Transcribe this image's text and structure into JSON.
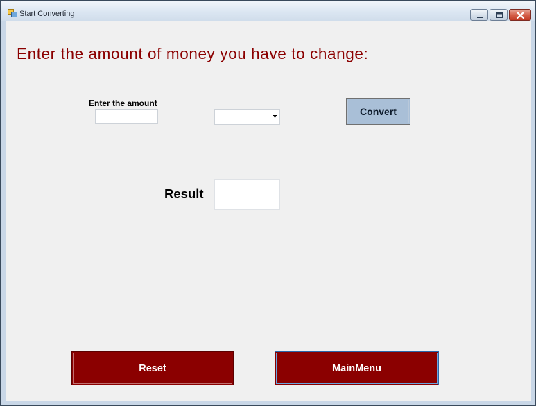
{
  "window": {
    "title": "Start Converting",
    "controls": [
      "minimize",
      "maximize",
      "close"
    ]
  },
  "main": {
    "heading": "Enter the amount of money you have to change:",
    "amount_label": "Enter the amount",
    "amount_value": "",
    "currency_selected": "",
    "convert_label": "Convert",
    "result_label": "Result",
    "result_value": ""
  },
  "footer": {
    "reset_label": "Reset",
    "mainmenu_label": "MainMenu"
  },
  "colors": {
    "heading": "#8b0000",
    "action_button": "#8b0000",
    "convert_button": "#a9bfd7",
    "client_background": "#f0f0f0"
  },
  "icons": {
    "app": "app-window-icon",
    "dropdown": "chevron-down-icon"
  }
}
